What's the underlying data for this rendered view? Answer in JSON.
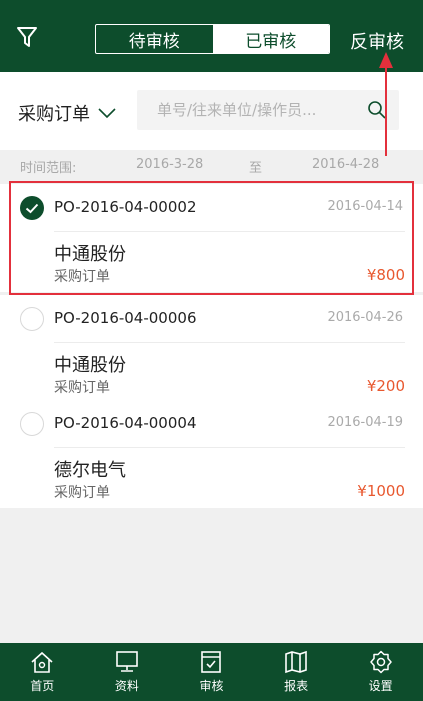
{
  "header": {
    "tabs": [
      {
        "label": "待审核",
        "active": false
      },
      {
        "label": "已审核",
        "active": true
      }
    ],
    "unaudit_label": "反审核"
  },
  "search": {
    "order_type": "采购订单",
    "placeholder": "单号/往来单位/操作员..."
  },
  "date_range": {
    "label": "时间范围:",
    "start": "2016-3-28",
    "separator": "至",
    "end": "2016-4-28"
  },
  "orders": [
    {
      "code": "PO-2016-04-00002",
      "date": "2016-04-14",
      "company": "中通股份",
      "type": "采购订单",
      "amount": "¥800",
      "selected": true
    },
    {
      "code": "PO-2016-04-00006",
      "date": "2016-04-26",
      "company": "中通股份",
      "type": "采购订单",
      "amount": "¥200",
      "selected": false
    },
    {
      "code": "PO-2016-04-00004",
      "date": "2016-04-19",
      "company": "德尔电气",
      "type": "采购订单",
      "amount": "¥1000",
      "selected": false
    }
  ],
  "colors": {
    "brand_green": "#0d4d2c",
    "amount_orange": "#e8582f",
    "highlight_red": "#e3303c"
  },
  "tabbar": {
    "items": [
      {
        "label": "首页",
        "icon": "home-icon"
      },
      {
        "label": "资料",
        "icon": "monitor-icon"
      },
      {
        "label": "审核",
        "icon": "audit-icon"
      },
      {
        "label": "报表",
        "icon": "map-book-icon"
      },
      {
        "label": "设置",
        "icon": "gear-icon"
      }
    ]
  }
}
